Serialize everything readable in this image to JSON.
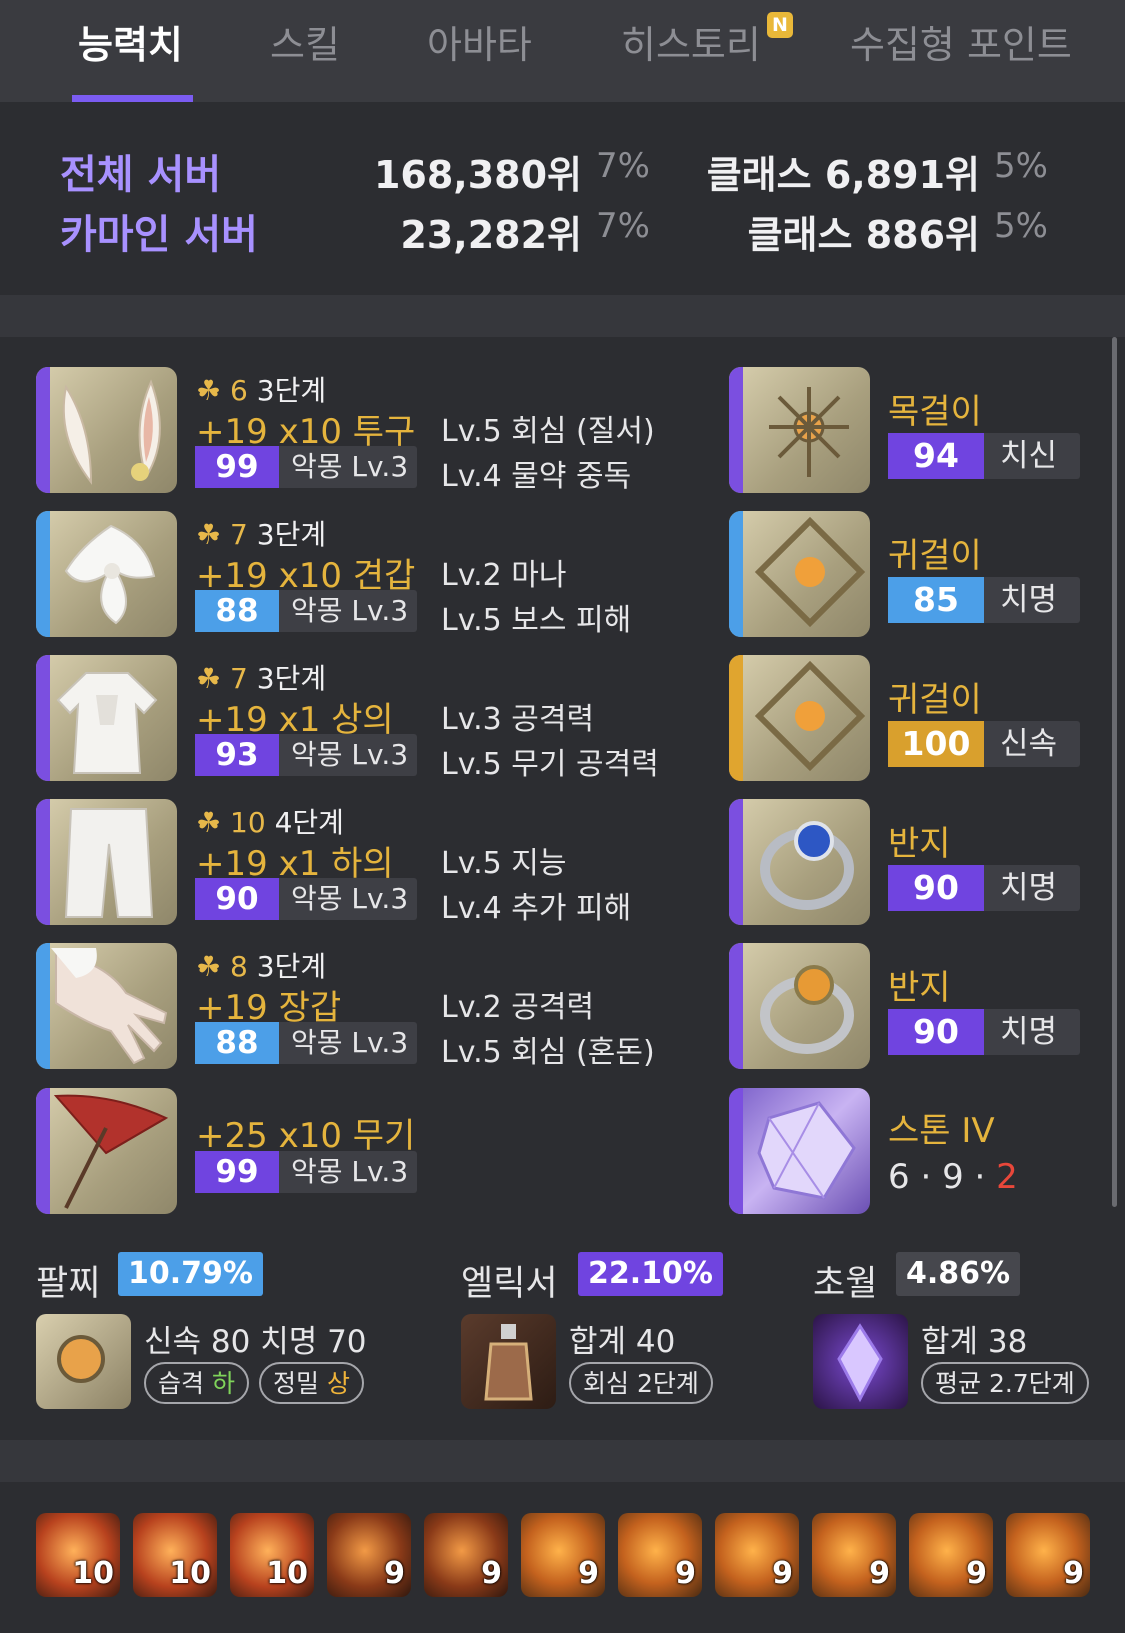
{
  "tabs": [
    {
      "label": "능력치",
      "active": true
    },
    {
      "label": "스킬"
    },
    {
      "label": "아바타"
    },
    {
      "label": "히스토리",
      "badge": "N"
    },
    {
      "label": "수집형 포인트"
    }
  ],
  "ranking": [
    {
      "server": "전체 서버",
      "rank": "168,380위",
      "rank_pct": "7%",
      "class_rank": "클래스 6,891위",
      "class_pct": "5%"
    },
    {
      "server": "카마인 서버",
      "rank": "23,282위",
      "rank_pct": "7%",
      "class_rank": "클래스 886위",
      "class_pct": "5%"
    }
  ],
  "equipment": [
    {
      "tier_num": "6",
      "tier_stage": "3단계",
      "refine": "+19",
      "adv": "x10",
      "slot": "투구",
      "quality": "99",
      "quality_color": "#7044e0",
      "set": "악몽 Lv.3",
      "engravings": [
        "Lv.5 회심 (질서)",
        "Lv.4 물약 중독"
      ],
      "icon": "helmet-icon",
      "bar": "purple"
    },
    {
      "tier_num": "7",
      "tier_stage": "3단계",
      "refine": "+19",
      "adv": "x10",
      "slot": "견갑",
      "quality": "88",
      "quality_color": "#4c9fe8",
      "set": "악몽 Lv.3",
      "engravings": [
        "Lv.2 마나",
        "Lv.5 보스 피해"
      ],
      "icon": "shoulder-icon",
      "bar": "blue"
    },
    {
      "tier_num": "7",
      "tier_stage": "3단계",
      "refine": "+19",
      "adv": "x1",
      "slot": "상의",
      "quality": "93",
      "quality_color": "#7044e0",
      "set": "악몽 Lv.3",
      "engravings": [
        "Lv.3 공격력",
        "Lv.5 무기 공격력"
      ],
      "icon": "chest-icon",
      "bar": "purple"
    },
    {
      "tier_num": "10",
      "tier_stage": "4단계",
      "refine": "+19",
      "adv": "x1",
      "slot": "하의",
      "quality": "90",
      "quality_color": "#7044e0",
      "set": "악몽 Lv.3",
      "engravings": [
        "Lv.5 지능",
        "Lv.4 추가 피해"
      ],
      "icon": "pants-icon",
      "bar": "purple"
    },
    {
      "tier_num": "8",
      "tier_stage": "3단계",
      "refine": "+19",
      "adv": "",
      "slot": "장갑",
      "quality": "88",
      "quality_color": "#4c9fe8",
      "set": "악몽 Lv.3",
      "engravings": [
        "Lv.2 공격력",
        "Lv.5 회심 (혼돈)"
      ],
      "icon": "gloves-icon",
      "bar": "blue"
    },
    {
      "tier_num": "",
      "tier_stage": "",
      "refine": "+25",
      "adv": "x10",
      "slot": "무기",
      "quality": "99",
      "quality_color": "#7044e0",
      "set": "악몽 Lv.3",
      "engravings": [],
      "icon": "weapon-icon",
      "bar": "purple"
    }
  ],
  "accessories": [
    {
      "name": "목걸이",
      "quality": "94",
      "quality_color": "#7044e0",
      "stat": "치신",
      "icon": "necklace-icon",
      "bar": "purple"
    },
    {
      "name": "귀걸이",
      "quality": "85",
      "quality_color": "#4c9fe8",
      "stat": "치명",
      "icon": "earring-icon",
      "bar": "blue"
    },
    {
      "name": "귀걸이",
      "quality": "100",
      "quality_color": "#d9a02d",
      "stat": "신속",
      "icon": "earring-icon",
      "bar": "gold"
    },
    {
      "name": "반지",
      "quality": "90",
      "quality_color": "#7044e0",
      "stat": "치명",
      "icon": "ring-icon",
      "bar": "purple"
    },
    {
      "name": "반지",
      "quality": "90",
      "quality_color": "#7044e0",
      "stat": "치명",
      "icon": "ring-icon",
      "bar": "purple"
    }
  ],
  "stone": {
    "name": "스톤 IV",
    "v1": "6",
    "v2": "9",
    "v3": "2",
    "sep": "·",
    "icon": "stone-icon"
  },
  "stats": {
    "bracelet": {
      "label": "팔찌",
      "pct": "10.79%",
      "desc": "신속 80 치명 70",
      "pill1_a": "습격",
      "pill1_b": "하",
      "pill2_a": "정밀",
      "pill2_b": "상"
    },
    "elixir": {
      "label": "엘릭서",
      "pct": "22.10%",
      "desc": "합계 40",
      "pill": "회심 2단계"
    },
    "transcend": {
      "label": "초월",
      "pct": "4.86%",
      "desc": "합계 38",
      "pill": "평균 2.7단계"
    }
  },
  "gems": [
    "10",
    "10",
    "10",
    "9",
    "9",
    "9",
    "9",
    "9",
    "9",
    "9",
    "9"
  ],
  "colors": {
    "accent": "#7b5cf2",
    "gold": "#e5b43d",
    "purple_quality": "#7044e0",
    "blue_quality": "#4c9fe8",
    "orange_quality": "#d9a02d",
    "stone_red": "#e8473a",
    "low_green": "#7fd35a",
    "high_orange": "#f0b43a"
  }
}
